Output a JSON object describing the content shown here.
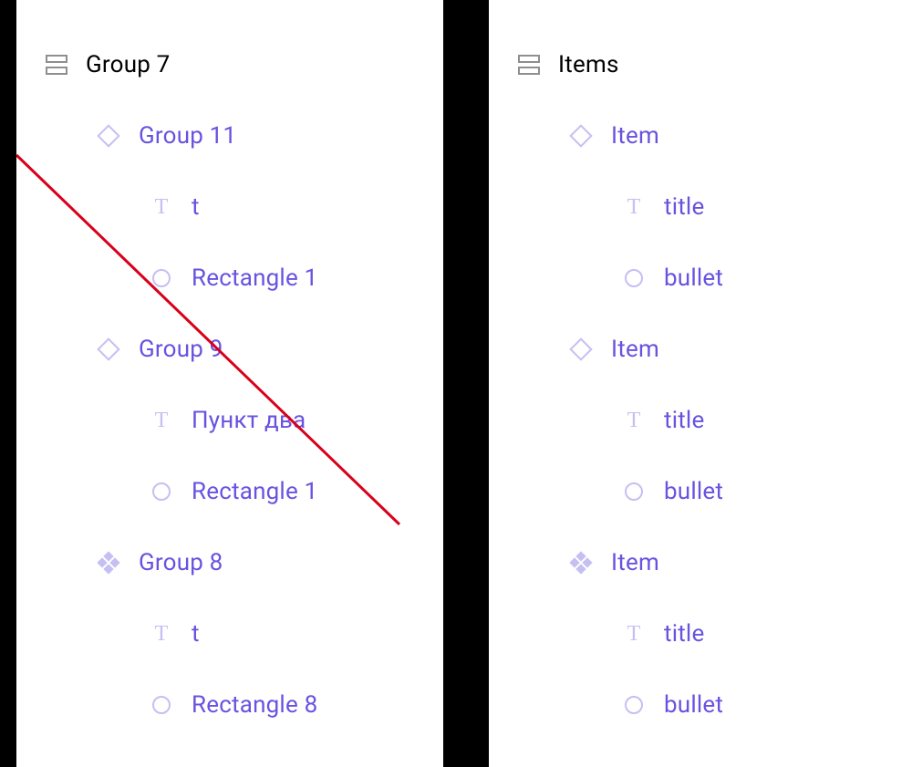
{
  "colors": {
    "accent": "#6853e0",
    "icon": "#c6bff2",
    "root": "#000000",
    "strike": "#d9001a"
  },
  "panels": {
    "left": {
      "root": {
        "icon": "frame",
        "label": "Group 7"
      },
      "items": [
        {
          "icon": "diamond",
          "label": "Group 11",
          "children": [
            {
              "icon": "text",
              "label": "t"
            },
            {
              "icon": "circle",
              "label": "Rectangle 1"
            }
          ]
        },
        {
          "icon": "diamond",
          "label": "Group 9",
          "children": [
            {
              "icon": "text",
              "label": "Пункт два"
            },
            {
              "icon": "circle",
              "label": "Rectangle 1"
            }
          ]
        },
        {
          "icon": "fourdiamond",
          "label": "Group 8",
          "children": [
            {
              "icon": "text",
              "label": "t"
            },
            {
              "icon": "circle",
              "label": "Rectangle 8"
            }
          ]
        }
      ],
      "strike": true
    },
    "right": {
      "root": {
        "icon": "frame",
        "label": "Items"
      },
      "items": [
        {
          "icon": "diamond",
          "label": "Item",
          "children": [
            {
              "icon": "text",
              "label": "title"
            },
            {
              "icon": "circle",
              "label": "bullet"
            }
          ]
        },
        {
          "icon": "diamond",
          "label": "Item",
          "children": [
            {
              "icon": "text",
              "label": "title"
            },
            {
              "icon": "circle",
              "label": "bullet"
            }
          ]
        },
        {
          "icon": "fourdiamond",
          "label": "Item",
          "children": [
            {
              "icon": "text",
              "label": "title"
            },
            {
              "icon": "circle",
              "label": "bullet"
            }
          ]
        }
      ],
      "strike": false
    }
  }
}
